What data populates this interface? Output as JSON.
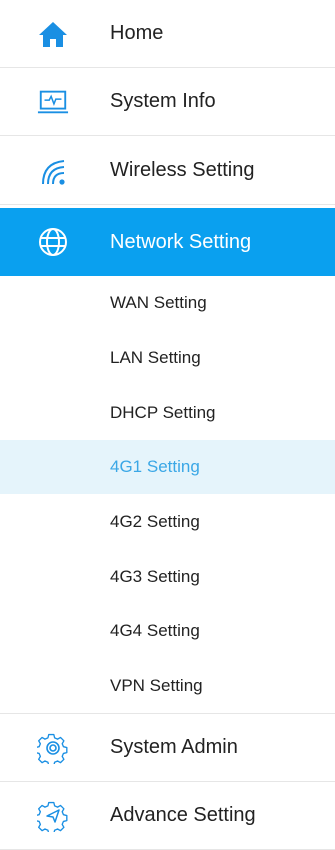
{
  "menu": {
    "home": {
      "label": "Home",
      "icon": "home-icon"
    },
    "system_info": {
      "label": "System Info",
      "icon": "monitor-icon"
    },
    "wireless": {
      "label": "Wireless Setting",
      "icon": "wifi-icon"
    },
    "network": {
      "label": "Network Setting",
      "icon": "globe-icon",
      "submenu": [
        {
          "label": "WAN Setting"
        },
        {
          "label": "LAN Setting"
        },
        {
          "label": "DHCP Setting"
        },
        {
          "label": "4G1 Setting"
        },
        {
          "label": "4G2 Setting"
        },
        {
          "label": "4G3 Setting"
        },
        {
          "label": "4G4 Setting"
        },
        {
          "label": "VPN Setting"
        }
      ],
      "selected_sub": "4G1 Setting"
    },
    "system_admin": {
      "label": "System Admin",
      "icon": "gear-icon"
    },
    "advance": {
      "label": "Advance Setting",
      "icon": "gear-send-icon"
    }
  },
  "colors": {
    "accent": "#0aa0ef",
    "icon_blue": "#1a8fe3",
    "selected_bg": "#e5f4fb",
    "selected_text": "#3aa7e6"
  }
}
